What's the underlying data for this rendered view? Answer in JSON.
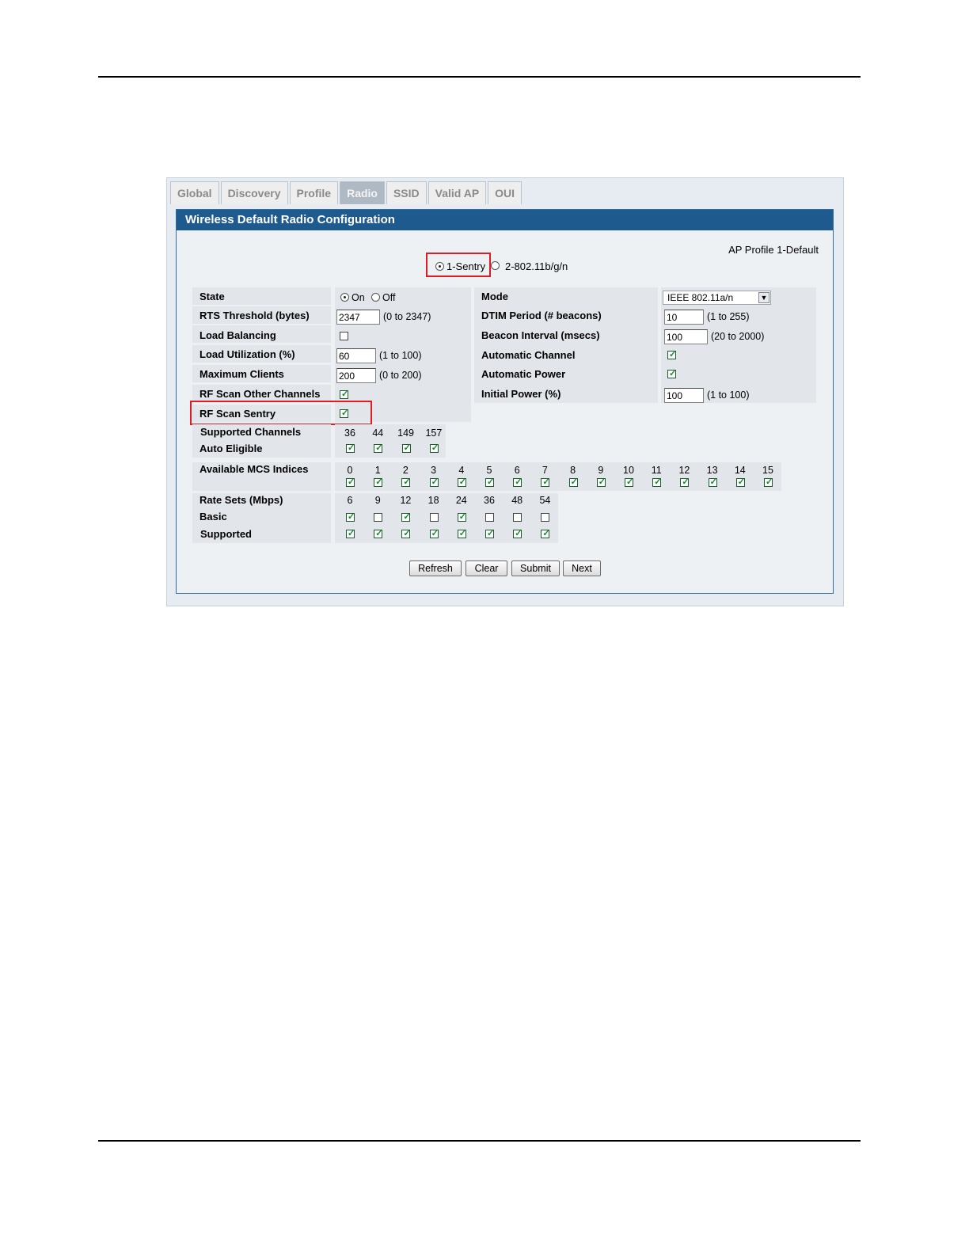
{
  "tabs": [
    "Global",
    "Discovery",
    "Profile",
    "Radio",
    "SSID",
    "Valid AP",
    "OUI"
  ],
  "active_tab": "Radio",
  "panel_title": "Wireless Default Radio Configuration",
  "ap_profile": "AP Profile 1-Default",
  "radios": {
    "selected": "1-Sentry",
    "option1": "1-Sentry",
    "option2": "2-802.11b/g/n"
  },
  "left": {
    "state_label": "State",
    "state_on": "On",
    "state_off": "Off",
    "rts_label": "RTS Threshold (bytes)",
    "rts_value": "2347",
    "rts_range": "(0 to 2347)",
    "load_balancing_label": "Load Balancing",
    "load_balancing": false,
    "load_util_label": "Load Utilization (%)",
    "load_util_value": "60",
    "load_util_range": "(1 to 100)",
    "max_clients_label": "Maximum Clients",
    "max_clients_value": "200",
    "max_clients_range": "(0 to 200)",
    "rf_scan_other_label": "RF Scan Other Channels",
    "rf_scan_other": true,
    "rf_scan_sentry_label": "RF Scan Sentry",
    "rf_scan_sentry": true
  },
  "right": {
    "mode_label": "Mode",
    "mode_value": "IEEE 802.11a/n",
    "dtim_label": "DTIM Period (# beacons)",
    "dtim_value": "10",
    "dtim_range": "(1 to 255)",
    "beacon_label": "Beacon Interval (msecs)",
    "beacon_value": "100",
    "beacon_range": "(20 to 2000)",
    "auto_channel_label": "Automatic Channel",
    "auto_channel": true,
    "auto_power_label": "Automatic Power",
    "auto_power": true,
    "initial_power_label": "Initial Power (%)",
    "initial_power_value": "100",
    "initial_power_range": "(1 to 100)"
  },
  "channels": {
    "supported_label": "Supported Channels",
    "auto_eligible_label": "Auto Eligible",
    "list": [
      "36",
      "44",
      "149",
      "157"
    ],
    "auto_eligible": [
      true,
      true,
      true,
      true
    ]
  },
  "mcs": {
    "label": "Available MCS Indices",
    "list": [
      "0",
      "1",
      "2",
      "3",
      "4",
      "5",
      "6",
      "7",
      "8",
      "9",
      "10",
      "11",
      "12",
      "13",
      "14",
      "15"
    ],
    "checked": [
      true,
      true,
      true,
      true,
      true,
      true,
      true,
      true,
      true,
      true,
      true,
      true,
      true,
      true,
      true,
      true
    ]
  },
  "rates": {
    "label": "Rate Sets (Mbps)",
    "basic_label": "Basic",
    "supported_label": "Supported",
    "list": [
      "6",
      "9",
      "12",
      "18",
      "24",
      "36",
      "48",
      "54"
    ],
    "basic": [
      true,
      false,
      true,
      false,
      true,
      false,
      false,
      false
    ],
    "supported": [
      true,
      true,
      true,
      true,
      true,
      true,
      true,
      true
    ]
  },
  "buttons": {
    "refresh": "Refresh",
    "clear": "Clear",
    "submit": "Submit",
    "next": "Next"
  },
  "colors": {
    "panel_title_bg": "#1e5a8e",
    "highlight_box": "#e01b24",
    "checkmark": "#138a2d"
  }
}
